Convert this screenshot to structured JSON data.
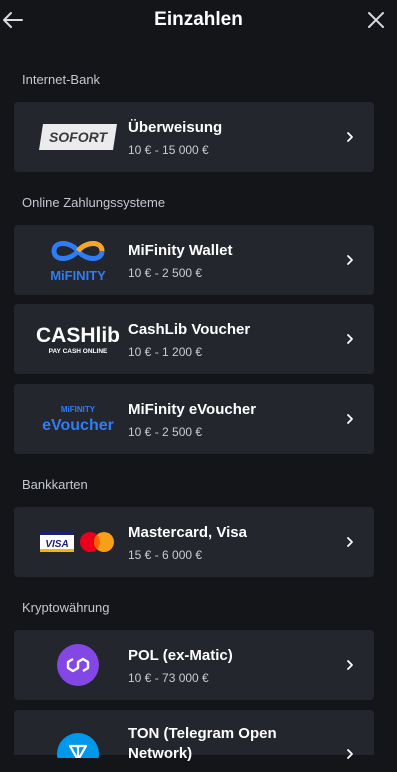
{
  "header": {
    "title": "Einzahlen"
  },
  "sections": [
    {
      "label": "Internet-Bank"
    },
    {
      "label": "Online Zahlungssysteme"
    },
    {
      "label": "Bankkarten"
    },
    {
      "label": "Kryptowährung"
    }
  ],
  "methods": [
    {
      "name": "Überweisung",
      "range": "10 € - 15 000 €",
      "logo_text": "SOFORT"
    },
    {
      "name": "MiFinity Wallet",
      "range": "10 € - 2 500 €",
      "logo_text": "MiFINITY"
    },
    {
      "name": "CashLib Voucher",
      "range": "10 € - 1 200 €",
      "logo_text": "CASHlib",
      "logo_subtext": "PAY CASH ONLINE"
    },
    {
      "name": "MiFinity eVoucher",
      "range": "10 € - 2 500 €",
      "logo_text": "eVoucher",
      "logo_subtext": "MiFINITY"
    },
    {
      "name": "Mastercard, Visa",
      "range": "15 € - 6 000 €",
      "logo_text": "VISA"
    },
    {
      "name": "POL (ex-Matic)",
      "range": "10 € - 73 000 €"
    },
    {
      "name": "TON (Telegram Open Network)",
      "range": ""
    }
  ],
  "colors": {
    "background": "#131519",
    "card": "#23262d",
    "accent_blue": "#2f7df6",
    "polygon_purple": "#8247e5",
    "ton_blue": "#0098ea"
  }
}
